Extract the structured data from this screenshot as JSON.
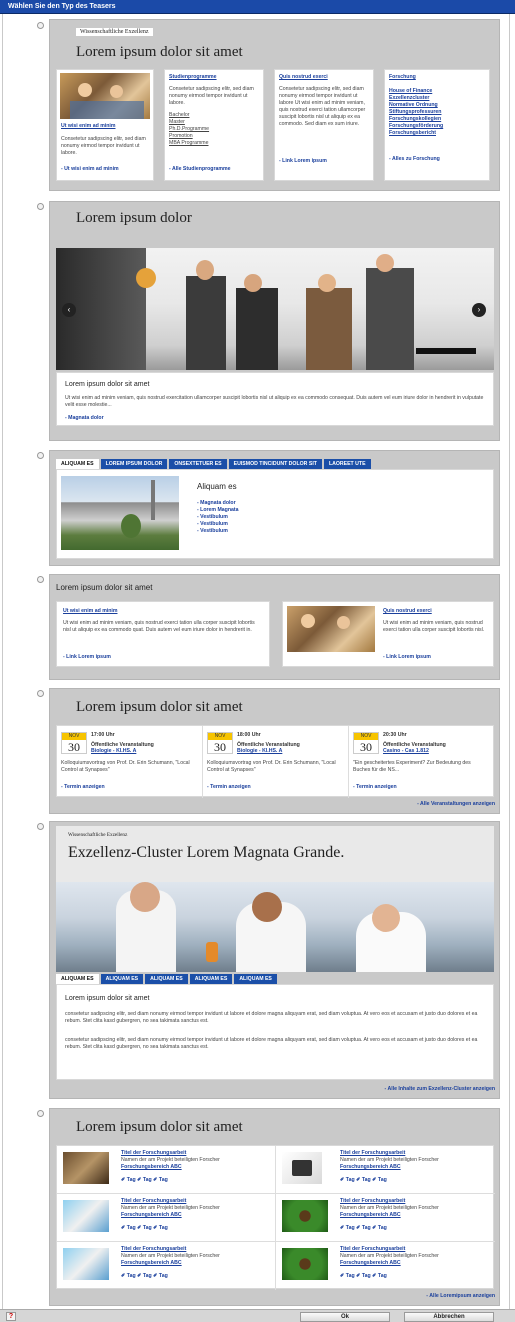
{
  "dialog": {
    "title": "Wählen Sie den Typ des Teasers"
  },
  "t1": {
    "kicker": "Wissenschaftliche Exzellenz",
    "heading": "Lorem ipsum dolor sit amet",
    "col1": {
      "link": "Ut wisi enim ad minim",
      "text": "Consetetur sadipscing elitr, sed diam nonumy eirmod tempor invidunt ut labore.",
      "more": "- Ut wisi enim ad minim"
    },
    "col2": {
      "title": "Studienprogramme",
      "text": "Consetetur sadipscing elitr, sed diam nonumy eirmod tempor invidunt ut labore.",
      "links": [
        "Bachelor",
        "Master",
        "Ph.D.Programme",
        "Promotion",
        "MBA Programme"
      ],
      "more": "- Alle Studienprogramme"
    },
    "col3": {
      "title": "Quis nostrud exerci",
      "text": "Consetetur sadipscing elitr, sed diam nonumy eirmod tempor invidunt ut labore Ut wisi enim ad minim veniam, quis nostrud exerci tation ullamcorper suscipit lobortis nisl ut aliquip ex ea commodo. Sed diam ex sum iriure.",
      "more": "- Link Lorem ipsum"
    },
    "col4": {
      "title": "Forschung",
      "links": [
        "House of Finance",
        "Exzellenzcluster",
        "Normative Ordnung",
        "Stiftungsprofessuren",
        "Forschungskollegien",
        "Forschungsförderung",
        "Forschungsbericht"
      ],
      "more": "- Alles zu Forschung"
    }
  },
  "t2": {
    "heading": "Lorem ipsum dolor",
    "caption_title": "Lorem ipsum dolor sit amet",
    "caption_text": "Ut wisi enim ad minim veniam, quis nostrud exercitation ullamcorper suscipit lobortis nisl ut aliquip ex ea commodo consequat. Duis autem vel eum iriure dolor in hendrerit in vulputate velit esse molestie...",
    "more": "- Magnata dolor",
    "prev": "‹",
    "next": "›"
  },
  "t3": {
    "tabs": [
      "ALIQUAM ES",
      "LOREM IPSUM DOLOR",
      "ONSEXTETUER ES",
      "EUISMOD TINCIDUNT DOLOR SIT",
      "LAOREET UTE"
    ],
    "heading": "Aliquam es",
    "links": [
      "- Magnata dolor",
      "- Lorem Magnata",
      "- Vestibulum",
      "- Vestibulum",
      "- Vestibulum"
    ]
  },
  "t4": {
    "heading": "Lorem ipsum dolor sit amet",
    "left": {
      "title": "Ut wisi enim ad minim",
      "text": "Ut wisi enim ad minim veniam, quis nostrud exerci tation ulla corper suscipit lobortis nisl ut aliquip ex ea commodo quat. Duis autem vel eum iriure dolor in hendrerit in.",
      "more": "- Link Lorem ipsum"
    },
    "right": {
      "title": "Quis nostrud exerci",
      "text": "Ut wisi enim ad minim veniam, quis nostrud exerci tation ulla corper suscipit lobortis nisl.",
      "more": "- Link Lorem ipsum"
    }
  },
  "t5": {
    "heading": "Lorem ipsum dolor sit amet",
    "events": [
      {
        "month": "NOV",
        "day": "30",
        "time": "17:00 Uhr",
        "type": "Öffentliche Veranstaltung",
        "place": "Biologie - KI.HS. A",
        "text": "Kolloquiumsvortrag von Prof. Dr. Erin Schumann, \"Local Control at Synapses\"",
        "more": "- Termin anzeigen"
      },
      {
        "month": "NOV",
        "day": "30",
        "time": "18:00 Uhr",
        "type": "Öffentliche Veranstaltung",
        "place": "Biologie - KI.HS. A",
        "text": "Kolloquiumsvortrag von Prof. Dr. Erin Schumann, \"Local Control at Synapses\"",
        "more": "- Termin anzeigen"
      },
      {
        "month": "NOV",
        "day": "30",
        "time": "20:30 Uhr",
        "type": "Öffentliche Veranstaltung",
        "place": "Casino - Cas 1.812",
        "text": "\"Ein gescheitertes Experiment? Zur Bedeutung des Buches für die NS...",
        "more": "- Termin anzeigen"
      }
    ],
    "all": "- Alle Veranstaltungen anzeigen"
  },
  "t6": {
    "kicker": "Wissenschaftliche Exzellenz",
    "heading": "Exzellenz-Cluster Lorem Magnata Grande.",
    "tabs": [
      "ALIQUAM ES",
      "ALIQUAM ES",
      "ALIQUAM ES",
      "ALIQUAM ES",
      "ALIQUAM ES"
    ],
    "box_title": "Lorem ipsum dolor sit amet",
    "p1": "consetetur sadipscing elitr, sed diam nonumy eirmod tempor invidunt ut labore et dolore magna aliquyam erat, sed diam voluptua. At vero eos et accusam et justo duo dolores et ea rebum. Stet clita kasd gubergren, no sea takimata sanctus est.",
    "p2": "consetetur sadipscing elitr, sed diam nonumy eirmod tempor invidunt ut labore et dolore magna aliquyam erat, sed diam voluptua. At vero eos et accusam et justo duo dolores et ea rebum. Stet clita kasd gubergren, no sea takimata sanctus est.",
    "all": "- Alle Inhalte zum Exzellenz-Cluster anzeigen"
  },
  "t7": {
    "heading": "Lorem ipsum dolor sit amet",
    "item": {
      "title": "Titel der Forschungsarbeit",
      "sub": "Namen der am Projekt beteiligten Forscher",
      "area": "Forschungsbereich ABC",
      "tags": "✐ Tag  ✐ Tag  ✐ Tag"
    },
    "all": "- Alle Loremipsum anzeigen"
  },
  "footer": {
    "help": "?",
    "ok": "Ok",
    "cancel": "Abbrechen"
  }
}
